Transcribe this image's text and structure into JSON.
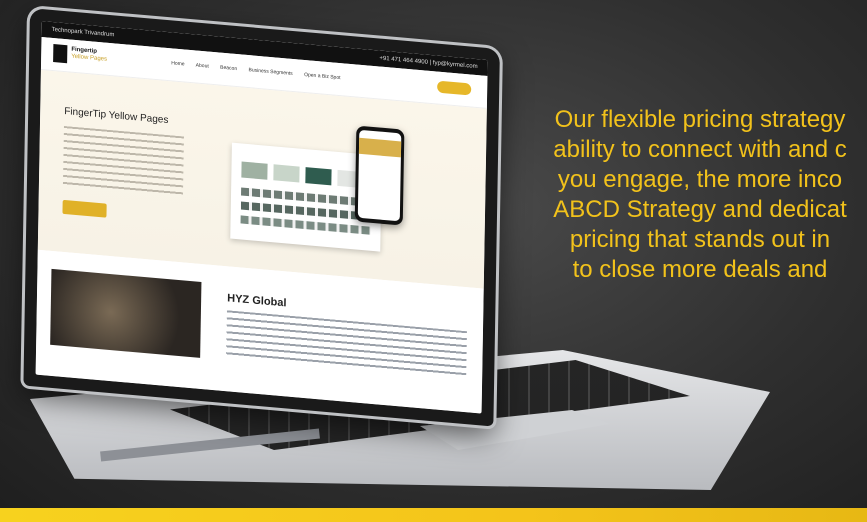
{
  "pitch_lines": [
    "Our flexible pricing strategy",
    "ability to connect with and c",
    "you engage, the more inco",
    "ABCD Strategy and dedicat",
    "pricing that stands out in",
    "to close more deals and"
  ],
  "screen": {
    "topbar_left": "Technopark Trivandrum",
    "topbar_right": "+91 471 464 4900   |   fyp@kyrmel.com",
    "logo_line1": "Fingertip",
    "logo_line2": "Yellow Pages",
    "menu": [
      "Home",
      "About",
      "Beacon",
      "Business Segments",
      "Open a Biz Spot"
    ],
    "hero_title": "FingerTip Yellow Pages",
    "hyz_title": "HYZ Global"
  },
  "colors": {
    "accent": "#f2c21b",
    "background": "#2f2f2f"
  }
}
